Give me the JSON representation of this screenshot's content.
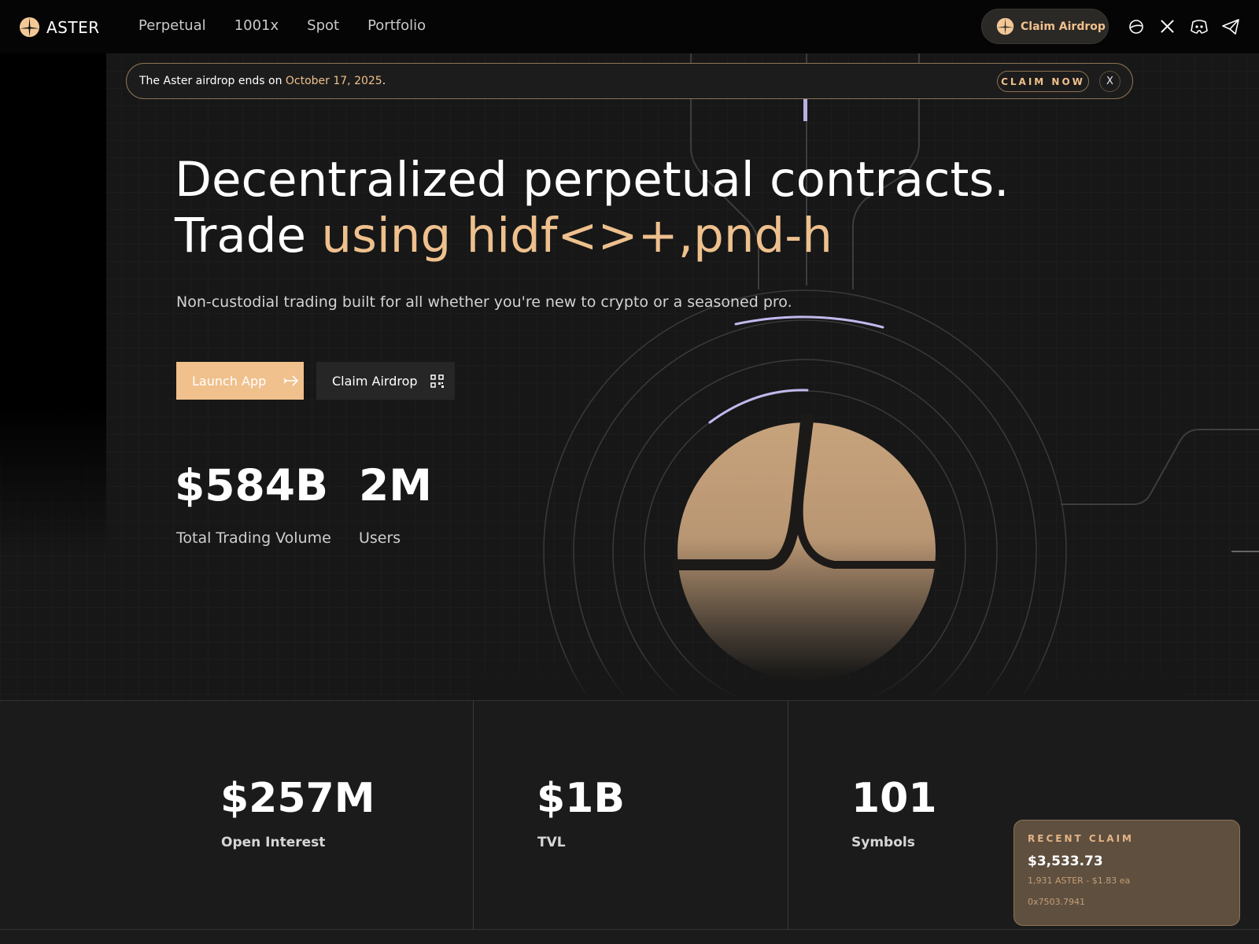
{
  "nav": {
    "logo_text": "ASTER",
    "links": [
      "Perpetual",
      "1001x",
      "Spot",
      "Portfolio"
    ],
    "cta_label": "Claim Airdrop",
    "icons": [
      "globe-icon",
      "x-icon",
      "discord-icon",
      "telegram-icon"
    ]
  },
  "banner": {
    "text_before": "The Aster airdrop ends on ",
    "date": "October 17, 2025",
    "text_after": ".",
    "claim_label": "CLAIM NOW",
    "close_label": "X"
  },
  "hero": {
    "headline_line1": "Decentralized perpetual contracts.",
    "headline_line2_prefix": "Trade ",
    "headline_line2_accent": "using hidf<>+,pnd-h",
    "subtitle": "Non-custodial trading built for all whether you're new to crypto or a seasoned pro.",
    "launch_label": "Launch App",
    "claim_label": "Claim Airdrop",
    "stats": [
      {
        "value": "$584B",
        "label": "Total Trading Volume"
      },
      {
        "value": "2M",
        "label": "Users"
      }
    ]
  },
  "metrics": [
    {
      "value": "$257M",
      "label": "Open Interest"
    },
    {
      "value": "$1B",
      "label": "TVL"
    },
    {
      "value": "101",
      "label": "Symbols"
    }
  ],
  "recent_claim": {
    "title": "RECENT CLAIM",
    "amount": "$3,533.73",
    "detail": "1,931 ASTER - $1.83 ea",
    "address": "0x7503.7941"
  },
  "colors": {
    "accent": "#f0c08d",
    "background": "#1b1b1b",
    "nav_background": "#050505",
    "toast_background": "#5f4f3f"
  }
}
